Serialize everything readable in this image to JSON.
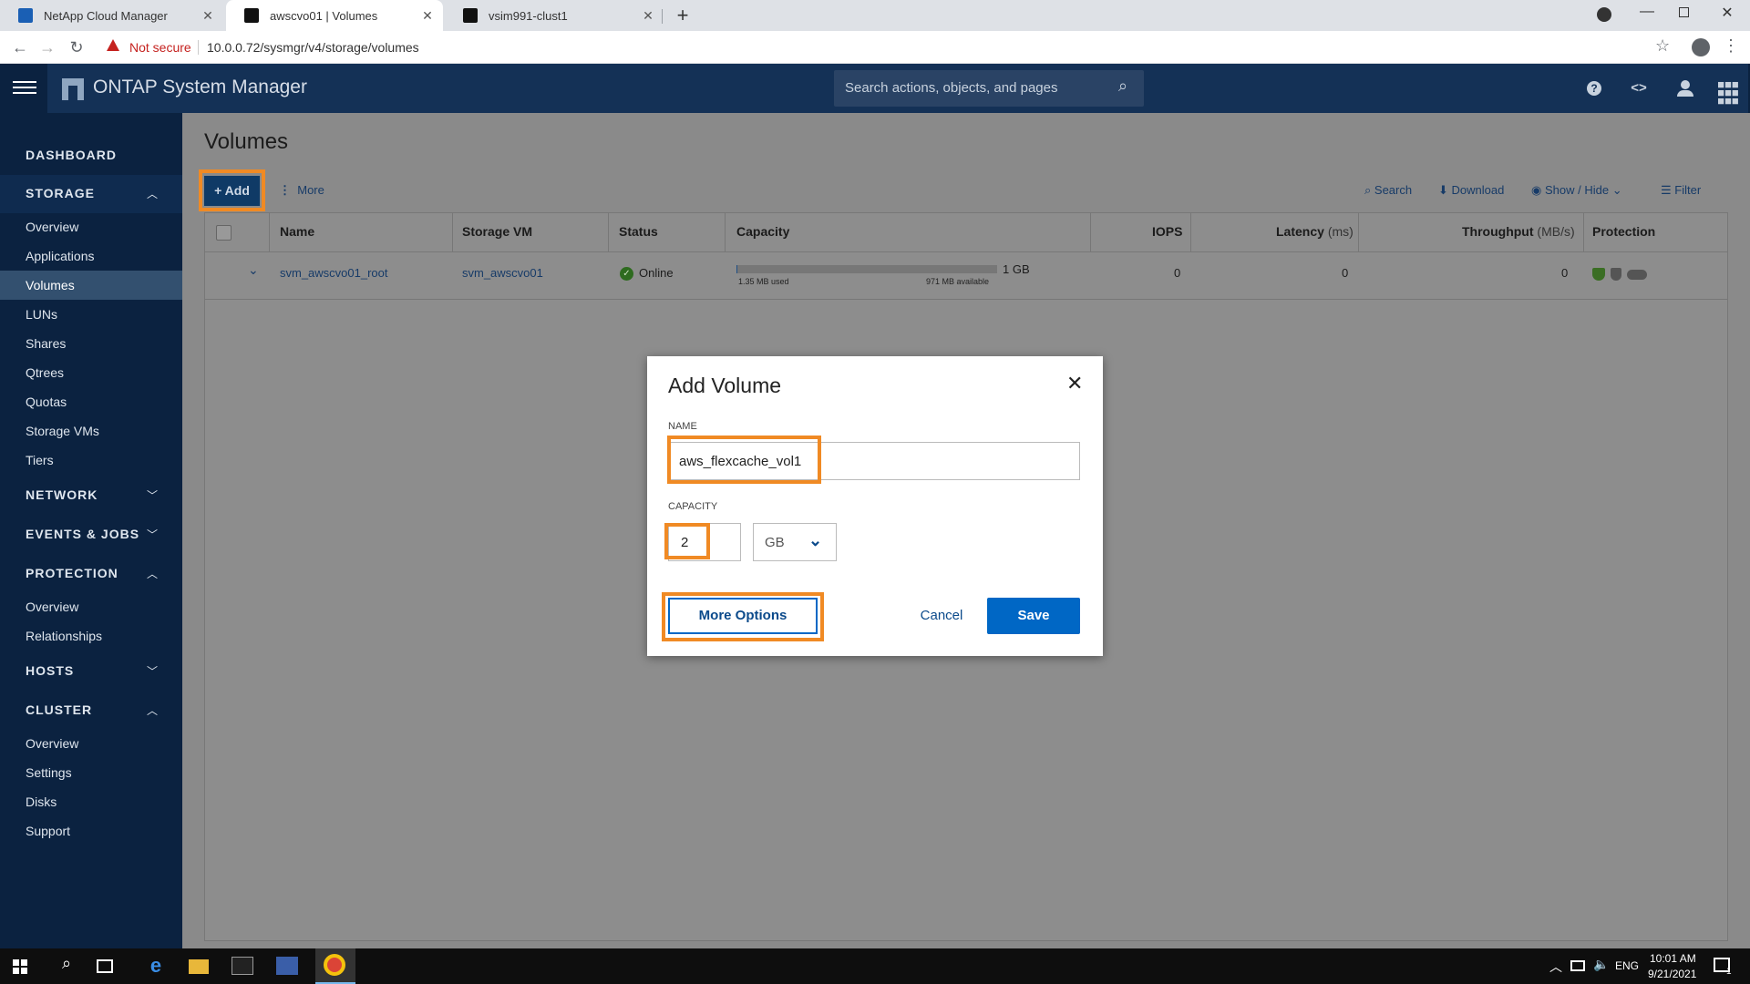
{
  "browser": {
    "tabs": [
      {
        "title": "NetApp Cloud Manager"
      },
      {
        "title": "awscvo01 | Volumes"
      },
      {
        "title": "vsim991-clust1"
      }
    ],
    "security_label": "Not secure",
    "url": "10.0.0.72/sysmgr/v4/storage/volumes"
  },
  "app": {
    "title": "ONTAP System Manager",
    "search_placeholder": "Search actions, objects, and pages"
  },
  "sidebar": {
    "dashboard": "DASHBOARD",
    "storage": {
      "label": "STORAGE",
      "items": [
        "Overview",
        "Applications",
        "Volumes",
        "LUNs",
        "Shares",
        "Qtrees",
        "Quotas",
        "Storage VMs",
        "Tiers"
      ]
    },
    "network": "NETWORK",
    "events": "EVENTS & JOBS",
    "protection": {
      "label": "PROTECTION",
      "items": [
        "Overview",
        "Relationships"
      ]
    },
    "hosts": "HOSTS",
    "cluster": {
      "label": "CLUSTER",
      "items": [
        "Overview",
        "Settings",
        "Disks",
        "Support"
      ]
    }
  },
  "page": {
    "title": "Volumes",
    "toolbar": {
      "add": "Add",
      "more": "More",
      "search": "Search",
      "download": "Download",
      "showhide": "Show / Hide",
      "filter": "Filter"
    },
    "table": {
      "headers": {
        "name": "Name",
        "svm": "Storage VM",
        "status": "Status",
        "capacity": "Capacity",
        "iops": "IOPS",
        "latency": "Latency",
        "latency_unit": "(ms)",
        "throughput": "Throughput",
        "throughput_unit": "(MB/s)",
        "protection": "Protection"
      },
      "rows": [
        {
          "name": "svm_awscvo01_root",
          "svm": "svm_awscvo01",
          "status": "Online",
          "capacity_total": "1 GB",
          "capacity_used": "1.35 MB used",
          "capacity_available": "971 MB available",
          "capacity_used_fraction": 0.0014,
          "iops": "0",
          "latency": "0",
          "throughput": "0"
        }
      ]
    }
  },
  "dialog": {
    "title": "Add Volume",
    "name_label": "NAME",
    "name_value": "aws_flexcache_vol1",
    "capacity_label": "CAPACITY",
    "capacity_value": "2",
    "unit_value": "GB",
    "more_options": "More Options",
    "cancel": "Cancel",
    "save": "Save"
  },
  "taskbar": {
    "lang": "ENG",
    "time": "10:01 AM",
    "date": "9/21/2021",
    "notification_count": "1"
  },
  "colors": {
    "accent": "#0067c5",
    "highlight": "#f08a24",
    "sidebar": "#0b2240"
  }
}
